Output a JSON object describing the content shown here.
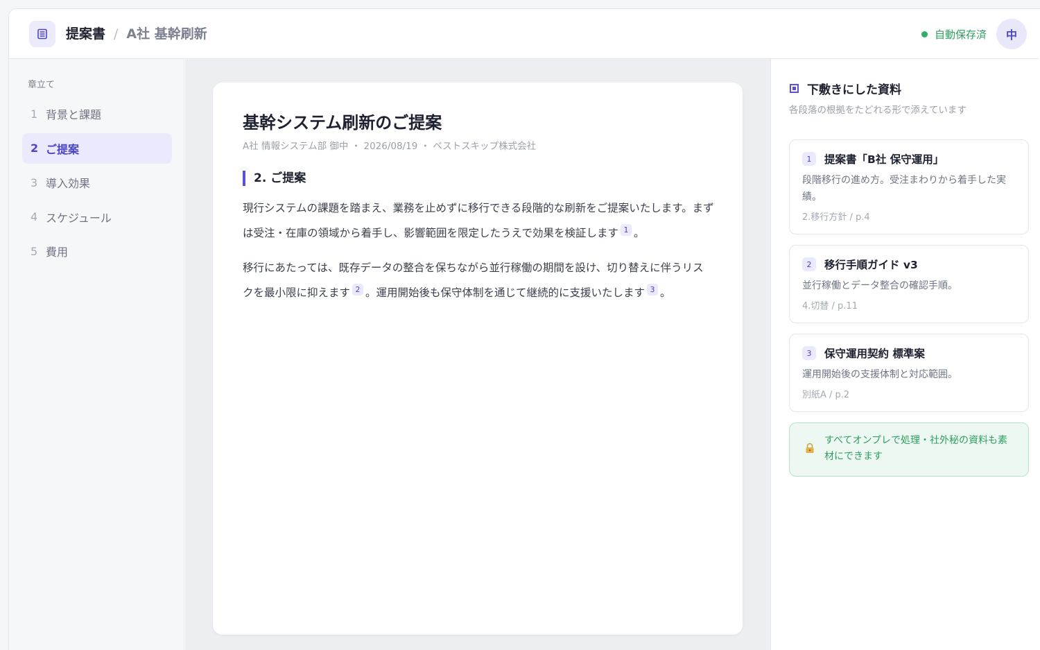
{
  "header": {
    "breadcrumb_root": "提案書",
    "breadcrumb_separator": "/",
    "breadcrumb_current": "A社 基幹刷新",
    "save_status": "自動保存済",
    "avatar_initial": "中"
  },
  "sidebar": {
    "heading": "章立て",
    "items": [
      {
        "num": "1",
        "label": "背景と課題"
      },
      {
        "num": "2",
        "label": "ご提案"
      },
      {
        "num": "3",
        "label": "導入効果"
      },
      {
        "num": "4",
        "label": "スケジュール"
      },
      {
        "num": "5",
        "label": "費用"
      }
    ],
    "active_index": 1
  },
  "document": {
    "title": "基幹システム刷新のご提案",
    "meta": "A社 情報システム部 御中 ・ 2026/08/19 ・ ベストスキップ株式会社",
    "section_heading": "2. ご提案",
    "para1_text": "現行システムの課題を踏まえ、業務を止めずに移行できる段階的な刷新をご提案いたします。まずは受注・在庫の領域から着手し、影響範囲を限定したうえで効果を検証します",
    "para1_cite": "1",
    "para1_end": "。",
    "para2_text_a": "移行にあたっては、既存データの整合を保ちながら並行稼働の期間を設け、切り替えに伴うリスクを最小限に抑えます",
    "para2_cite_a": "2",
    "para2_text_b": "。運用開始後も保守体制を通じて継続的に支援いたします",
    "para2_cite_b": "3",
    "para2_end": "。"
  },
  "references": {
    "title": "下敷きにした資料",
    "subtitle": "各段落の根拠をたどれる形で添えています",
    "items": [
      {
        "num": "1",
        "title": "提案書「B社 保守運用」",
        "desc": "段階移行の進め方。受注まわりから着手した実績。",
        "loc": "2.移行方針 / p.4"
      },
      {
        "num": "2",
        "title": "移行手順ガイド v3",
        "desc": "並行稼働とデータ整合の確認手順。",
        "loc": "4.切替 / p.11"
      },
      {
        "num": "3",
        "title": "保守運用契約 標準案",
        "desc": "運用開始後の支援体制と対応範囲。",
        "loc": "別紙A / p.2"
      }
    ],
    "notice": "すべてオンプレで処理・社外秘の資料も素材にできます"
  },
  "colors": {
    "accent": "#5a52d6",
    "success": "#2f9e61",
    "notice_bg": "#ecf8f1"
  },
  "icons": {
    "doc": "document-list-icon",
    "status": "status-dot-icon",
    "refs": "reference-square-icon",
    "lock": "lock-icon"
  }
}
